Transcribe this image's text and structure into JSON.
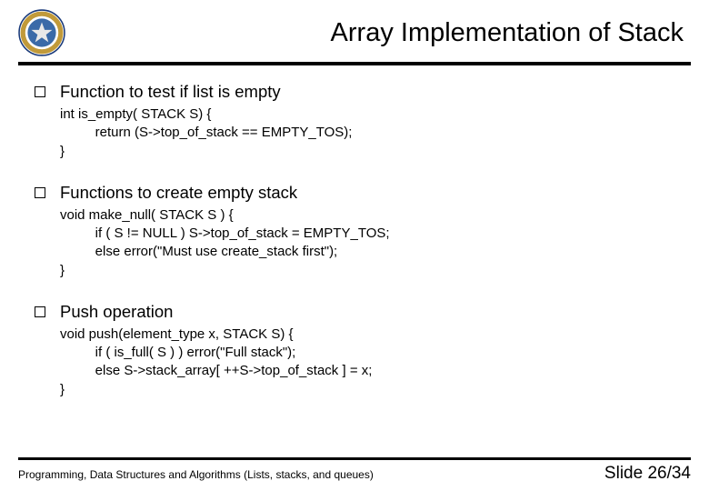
{
  "title": "Array Implementation of Stack",
  "sections": [
    {
      "heading": "Function to test if list is empty",
      "code": [
        "int is_empty( STACK S) {",
        "    return (S->top_of_stack == EMPTY_TOS);",
        "}"
      ]
    },
    {
      "heading": "Functions to create empty stack",
      "code": [
        "void make_null( STACK S ) {",
        "    if ( S != NULL ) S->top_of_stack = EMPTY_TOS;",
        "    else error(\"Must use create_stack first\");",
        "}"
      ]
    },
    {
      "heading": "Push operation",
      "code": [
        "void push(element_type x, STACK S) {",
        "    if ( is_full( S ) ) error(\"Full stack\");",
        "    else S->stack_array[ ++S->top_of_stack ] = x;",
        "}"
      ]
    }
  ],
  "footer_left": "Programming, Data Structures and Algorithms  (Lists, stacks, and queues)",
  "footer_right": "Slide 26/34"
}
